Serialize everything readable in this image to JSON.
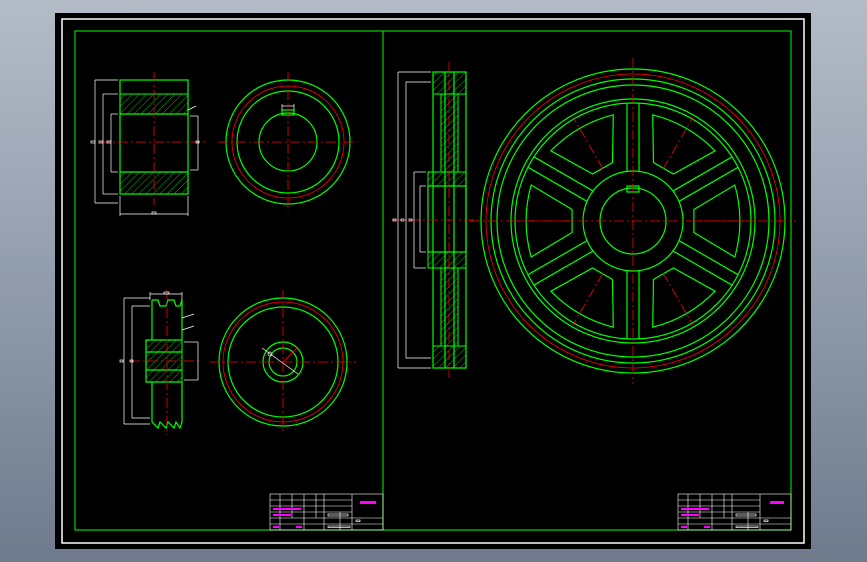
{
  "colors": {
    "background_gradient_top": "#b4bcc8",
    "background_gradient_bottom": "#6f7b8c",
    "paper": "#000000",
    "outline": "#00ff00",
    "centerline": "#ff0000",
    "dimension": "#ffffff",
    "title_marker": "#ff00ff"
  },
  "views": [
    "small-pulley-section-view",
    "small-pulley-end-view",
    "v-pulley-section-view",
    "v-pulley-end-view",
    "large-spoked-pulley-section-view",
    "large-spoked-pulley-front-view"
  ],
  "title_blocks": [
    "title-block-left",
    "title-block-right"
  ]
}
